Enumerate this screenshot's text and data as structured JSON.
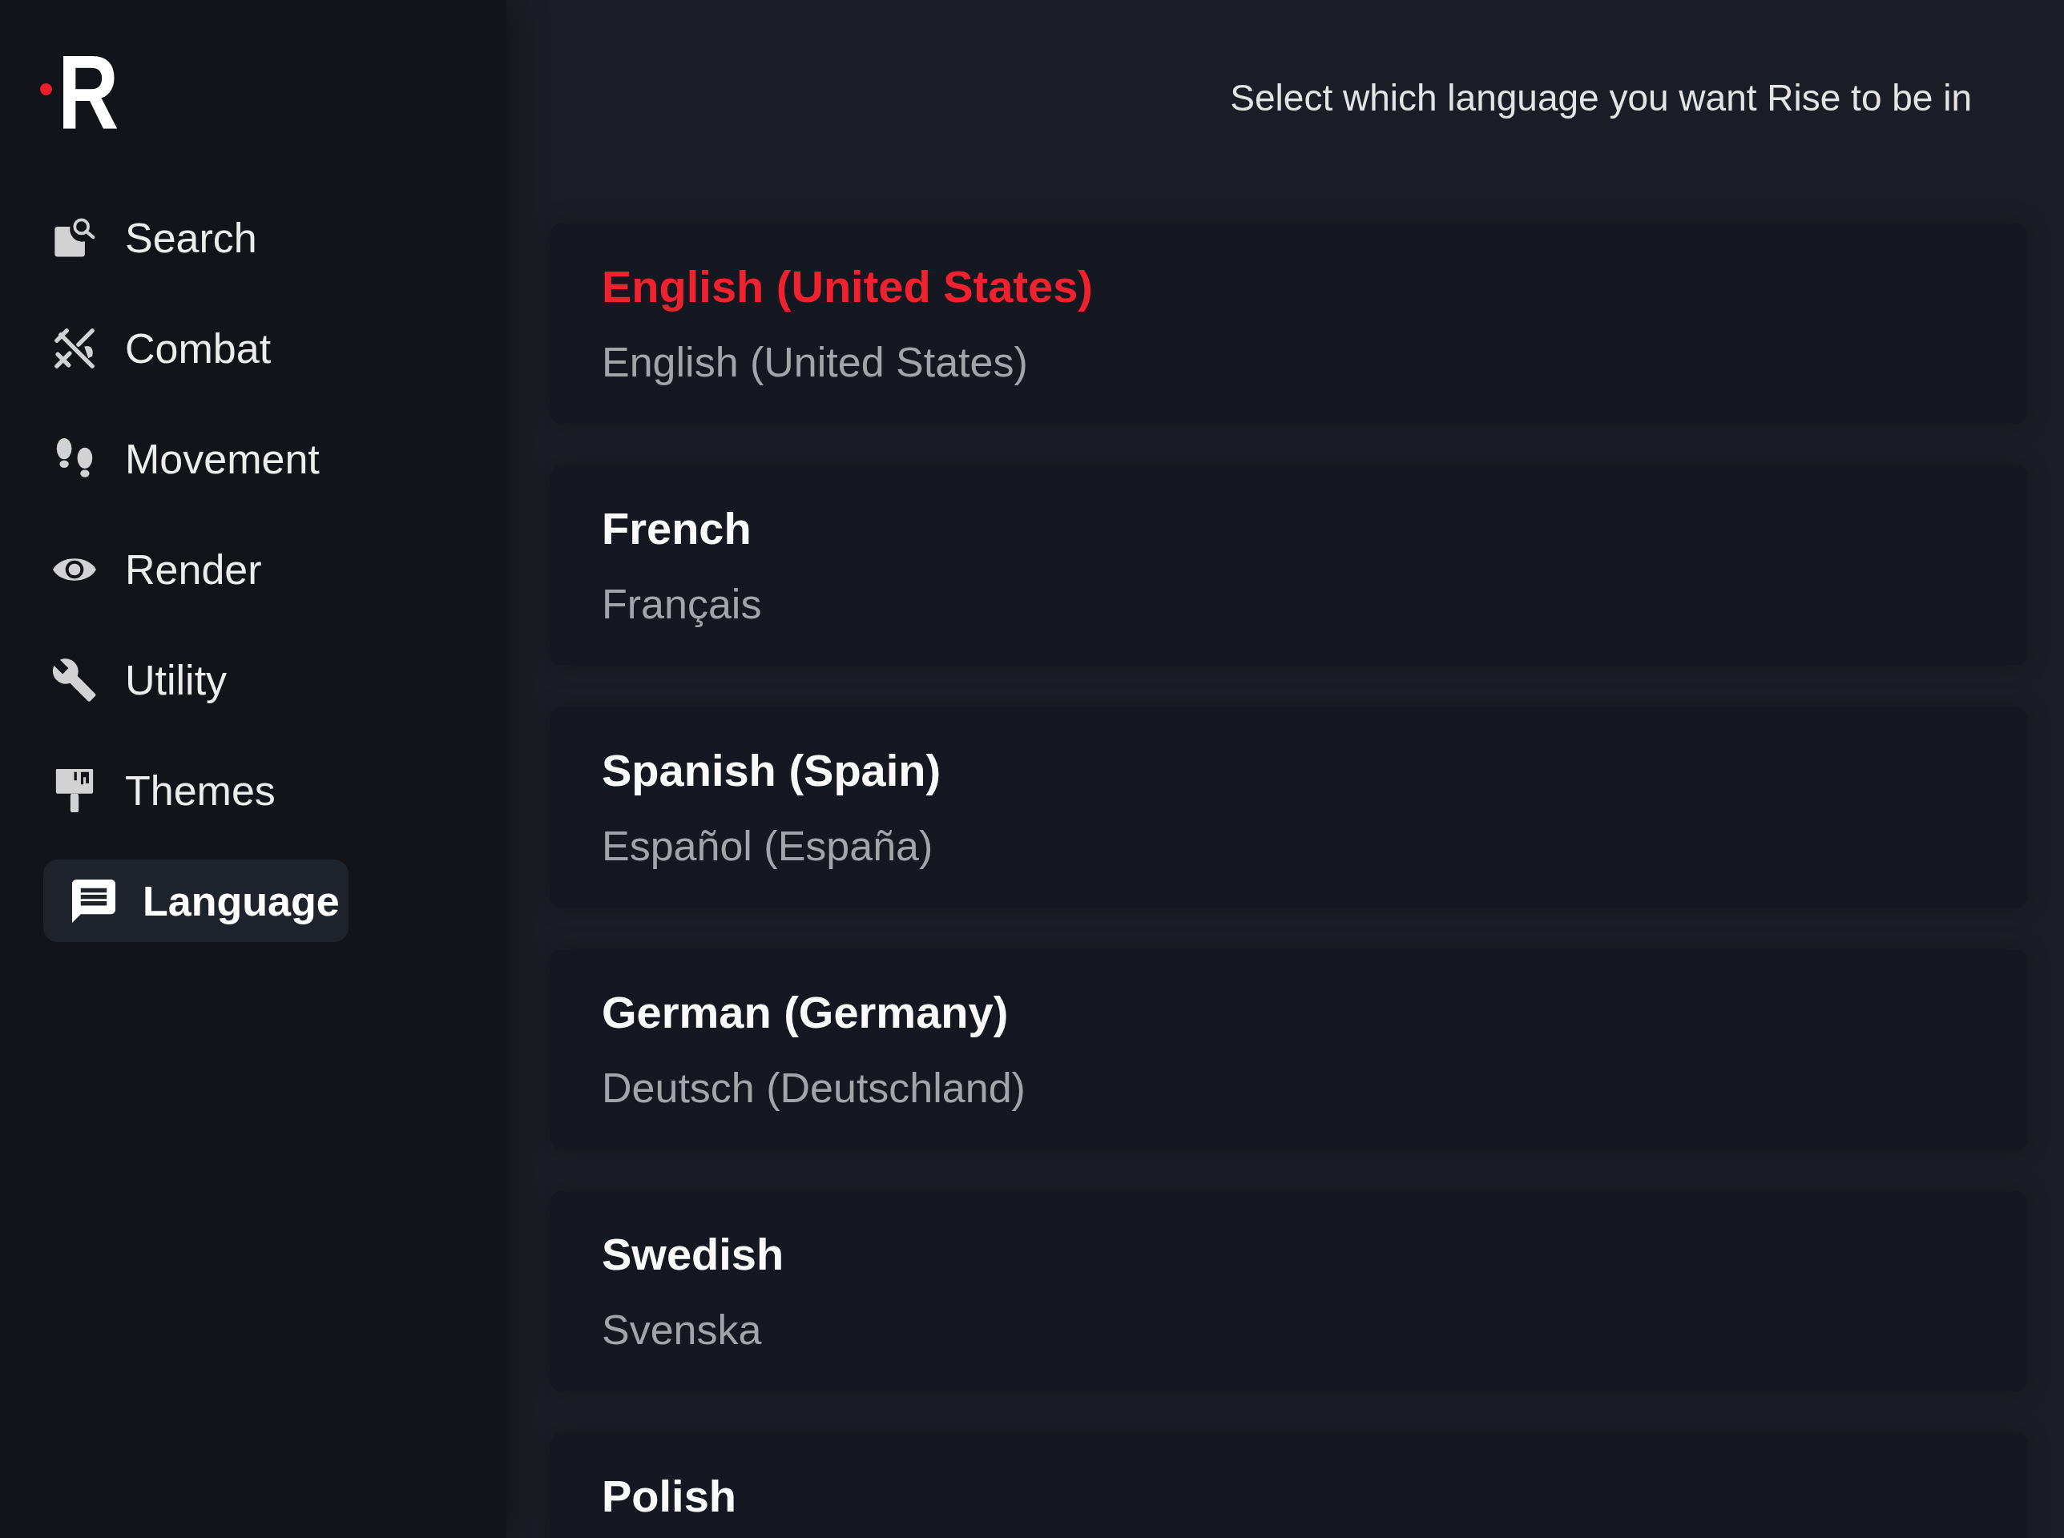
{
  "logo": {
    "text": "R"
  },
  "sidebar": {
    "items": [
      {
        "label": "Search",
        "selected": false
      },
      {
        "label": "Combat",
        "selected": false
      },
      {
        "label": "Movement",
        "selected": false
      },
      {
        "label": "Render",
        "selected": false
      },
      {
        "label": "Utility",
        "selected": false
      },
      {
        "label": "Themes",
        "selected": false
      },
      {
        "label": "Language",
        "selected": true
      }
    ]
  },
  "header": {
    "text": "Select which language you want Rise to be in"
  },
  "languages": [
    {
      "name": "English (United States)",
      "native": "English (United States)",
      "selected": true
    },
    {
      "name": "French",
      "native": "Français",
      "selected": false
    },
    {
      "name": "Spanish (Spain)",
      "native": "Español (España)",
      "selected": false
    },
    {
      "name": "German (Germany)",
      "native": "Deutsch (Deutschland)",
      "selected": false
    },
    {
      "name": "Swedish",
      "native": "Svenska",
      "selected": false
    },
    {
      "name": "Polish",
      "selected": false
    }
  ]
}
